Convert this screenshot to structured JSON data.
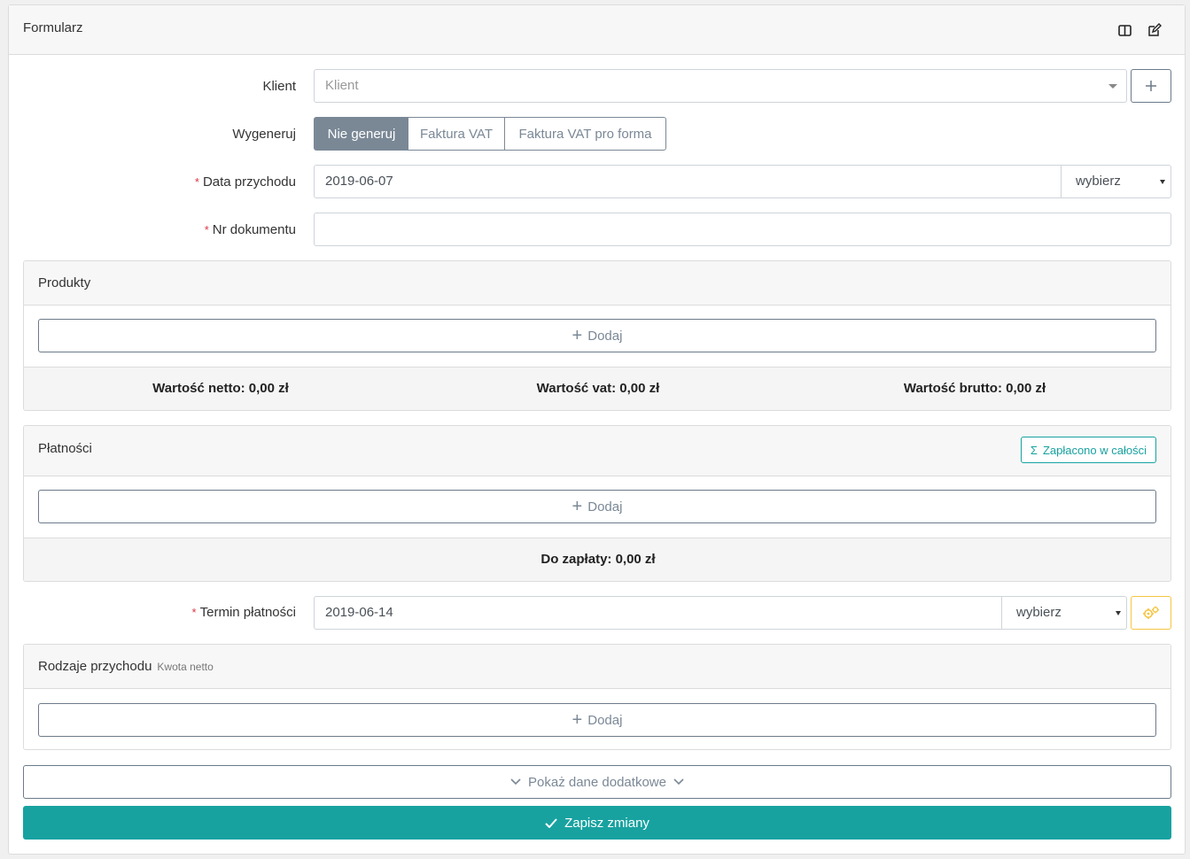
{
  "card": {
    "title": "Formularz"
  },
  "form": {
    "client": {
      "label": "Klient",
      "placeholder": "Klient"
    },
    "generate": {
      "label": "Wygeneruj",
      "options": [
        "Nie generuj",
        "Faktura VAT",
        "Faktura VAT pro forma"
      ],
      "selected": "Nie generuj"
    },
    "income_date": {
      "label": "Data przychodu",
      "value": "2019-06-07",
      "select": "wybierz"
    },
    "doc_number": {
      "label": "Nr dokumentu",
      "value": ""
    },
    "payment_due": {
      "label": "Termin płatności",
      "value": "2019-06-14",
      "select": "wybierz"
    }
  },
  "products": {
    "title": "Produkty",
    "add_label": "Dodaj",
    "net": "Wartość netto: 0,00 zł",
    "vat": "Wartość vat: 0,00 zł",
    "gross": "Wartość brutto: 0,00 zł"
  },
  "payments": {
    "title": "Płatności",
    "paid_button": "Zapłacono w całości",
    "add_label": "Dodaj",
    "to_pay": "Do zapłaty: 0,00 zł"
  },
  "income_types": {
    "title": "Rodzaje przychodu",
    "subtitle": "Kwota netto",
    "add_label": "Dodaj"
  },
  "actions": {
    "more": "Pokaż dane dodatkowe",
    "save": "Zapisz zmiany"
  },
  "colors": {
    "accent": "#17a2a0",
    "secondary": "#7a8896",
    "warning": "#f5c542",
    "required": "#dc3545"
  }
}
